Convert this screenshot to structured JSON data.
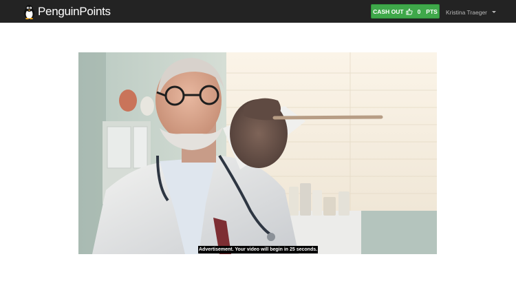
{
  "brand": {
    "name": "PenguinPoints",
    "logo_icon": "penguin-icon"
  },
  "header": {
    "cashout_label": "CASH OUT",
    "cashout_icon": "thumbs-up-icon",
    "points_value": "0",
    "points_unit": "PTS",
    "cashout_color": "#3fa84a",
    "user_name": "Kristina Traeger",
    "user_menu_icon": "caret-down-icon"
  },
  "video": {
    "caption": "Advertisement. Your video will begin in 25 seconds."
  }
}
